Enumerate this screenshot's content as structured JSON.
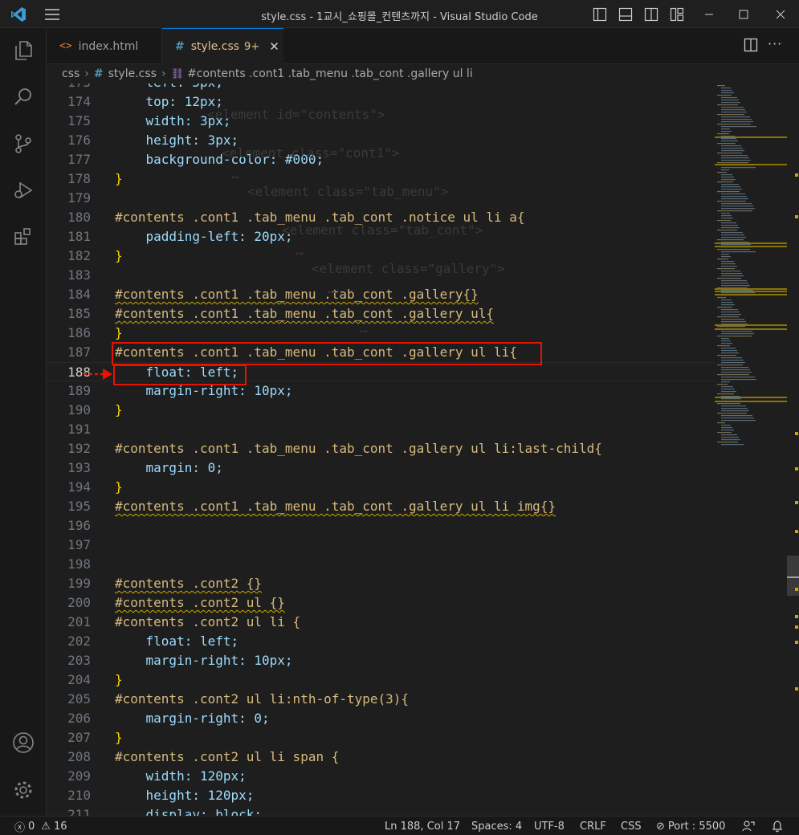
{
  "window": {
    "title": "style.css - 1교시_쇼핑몰_컨텐츠까지 - Visual Studio Code"
  },
  "tabs": [
    {
      "label": "index.html",
      "icon": "html-icon"
    },
    {
      "label": "style.css",
      "badge": "9+",
      "icon": "css-hash-icon"
    }
  ],
  "breadcrumb": {
    "folder": "css",
    "file": "style.css",
    "symbol": "#contents .cont1 .tab_menu .tab_cont .gallery ul li"
  },
  "hover_preview": {
    "line1": "<element id=\"contents\">",
    "line2": "<element class=\"cont1\">",
    "line3": "<element class=\"tab_menu\">",
    "line4": "<element class=\"tab_cont\">",
    "line5": "<element class=\"gallery\">",
    "ellipsis": "…"
  },
  "code": {
    "current_line": 188,
    "lines": [
      {
        "n": "173",
        "text": "    left: 5px;"
      },
      {
        "n": "174",
        "text": "    top: 12px;"
      },
      {
        "n": "175",
        "text": "    width: 3px;"
      },
      {
        "n": "176",
        "text": "    height: 3px;"
      },
      {
        "n": "177",
        "text": "    background-color: #000;"
      },
      {
        "n": "178",
        "text": "}"
      },
      {
        "n": "179",
        "text": ""
      },
      {
        "n": "180",
        "text": "#contents .cont1 .tab_menu .tab_cont .notice ul li a{"
      },
      {
        "n": "181",
        "text": "    padding-left: 20px;"
      },
      {
        "n": "182",
        "text": "}"
      },
      {
        "n": "183",
        "text": ""
      },
      {
        "n": "184",
        "text": "#contents .cont1 .tab_menu .tab_cont .gallery{}"
      },
      {
        "n": "185",
        "text": "#contents .cont1 .tab_menu .tab_cont .gallery ul{"
      },
      {
        "n": "186",
        "text": "}"
      },
      {
        "n": "187",
        "text": "#contents .cont1 .tab_menu .tab_cont .gallery ul li{"
      },
      {
        "n": "188",
        "text": "    float: left;"
      },
      {
        "n": "189",
        "text": "    margin-right: 10px;"
      },
      {
        "n": "190",
        "text": "}"
      },
      {
        "n": "191",
        "text": ""
      },
      {
        "n": "192",
        "text": "#contents .cont1 .tab_menu .tab_cont .gallery ul li:last-child{"
      },
      {
        "n": "193",
        "text": "    margin: 0;"
      },
      {
        "n": "194",
        "text": "}"
      },
      {
        "n": "195",
        "text": "#contents .cont1 .tab_menu .tab_cont .gallery ul li img{}"
      },
      {
        "n": "196",
        "text": ""
      },
      {
        "n": "197",
        "text": ""
      },
      {
        "n": "198",
        "text": ""
      },
      {
        "n": "199",
        "text": "#contents .cont2 {}"
      },
      {
        "n": "200",
        "text": "#contents .cont2 ul {}"
      },
      {
        "n": "201",
        "text": "#contents .cont2 ul li {"
      },
      {
        "n": "202",
        "text": "    float: left;"
      },
      {
        "n": "203",
        "text": "    margin-right: 10px;"
      },
      {
        "n": "204",
        "text": "}"
      },
      {
        "n": "205",
        "text": "#contents .cont2 ul li:nth-of-type(3){"
      },
      {
        "n": "206",
        "text": "    margin-right: 0;"
      },
      {
        "n": "207",
        "text": "}"
      },
      {
        "n": "208",
        "text": "#contents .cont2 ul li span {"
      },
      {
        "n": "209",
        "text": "    width: 120px;"
      },
      {
        "n": "210",
        "text": "    height: 120px;"
      },
      {
        "n": "211",
        "text": "    display: block;"
      }
    ]
  },
  "status": {
    "errors": "0",
    "warnings": "16",
    "position": "Ln 188, Col 17",
    "spaces": "Spaces: 4",
    "encoding": "UTF-8",
    "eol": "CRLF",
    "language": "CSS",
    "port": "Port : 5500"
  },
  "colors": {
    "accent": "#0078d4",
    "annotation": "#e51400",
    "warning": "#cca700"
  }
}
